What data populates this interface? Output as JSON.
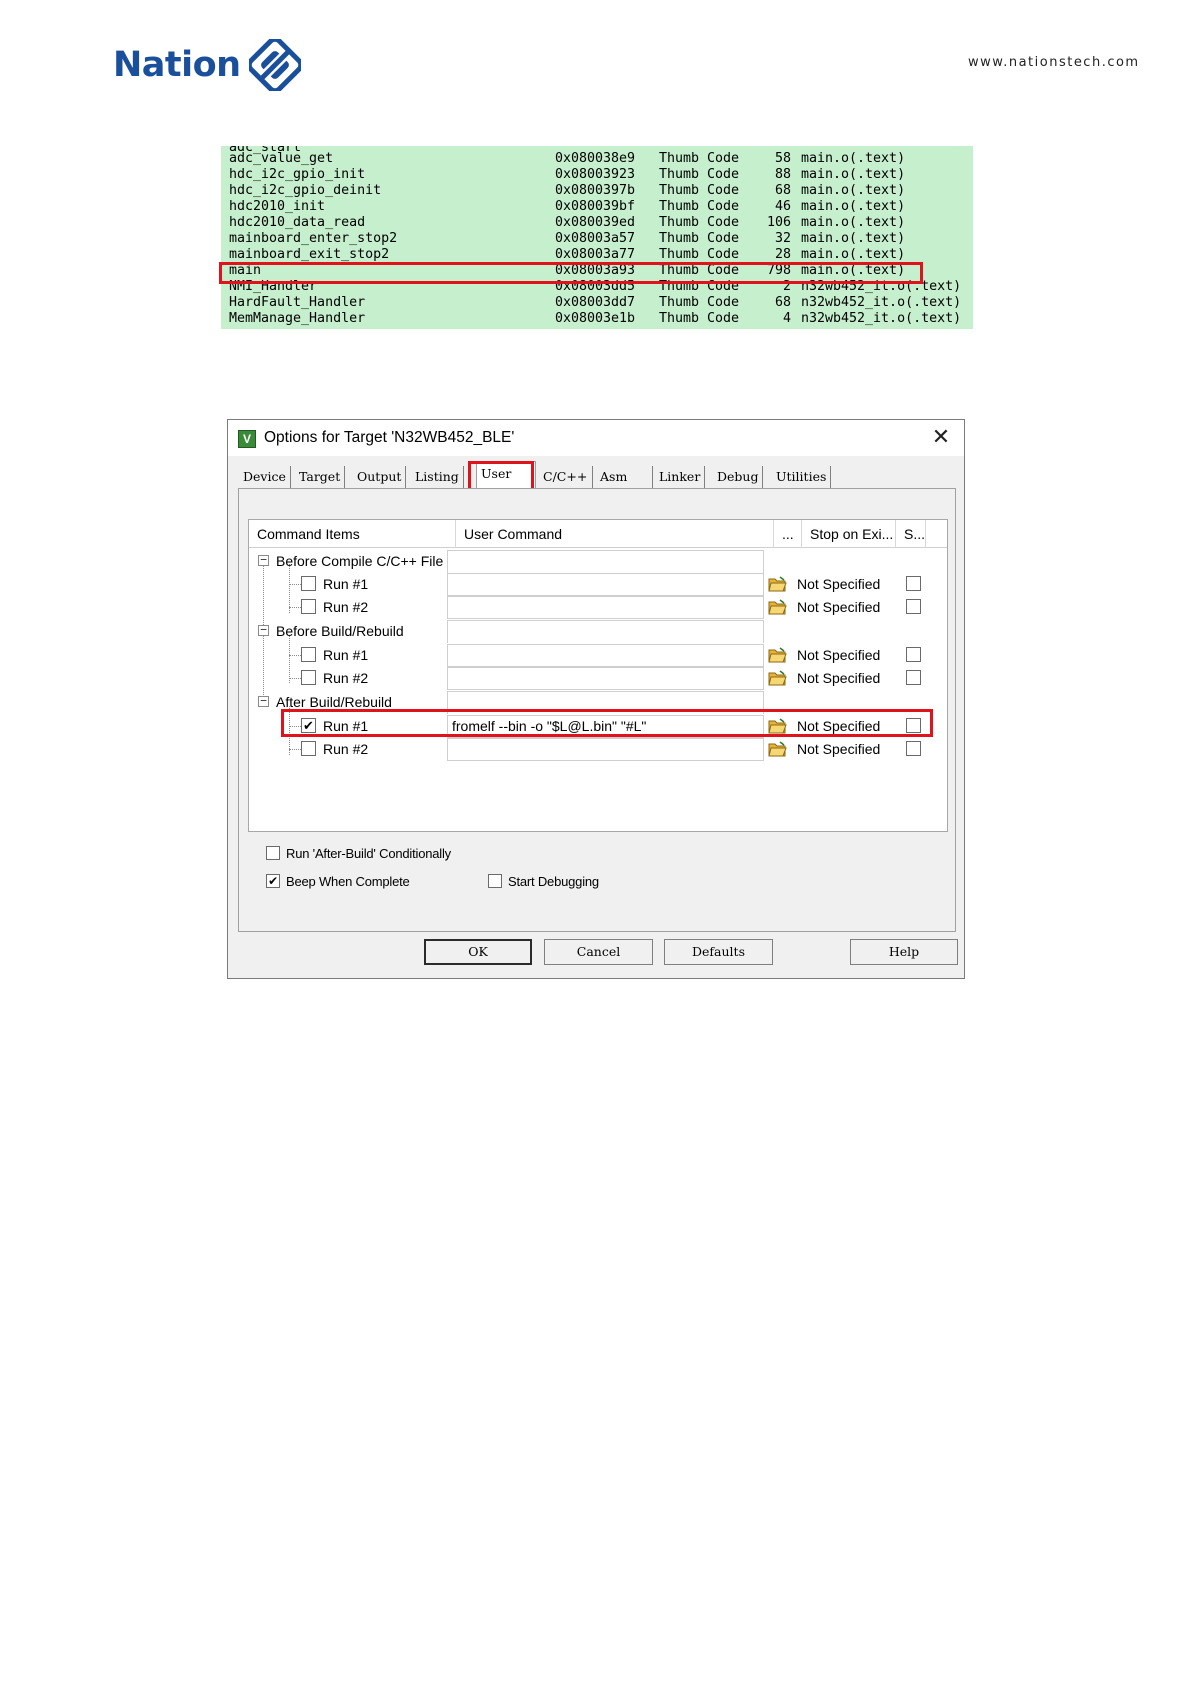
{
  "header": {
    "logo_text": "Nation",
    "website": "www.nationstech.com"
  },
  "map_listing": {
    "rows": [
      {
        "symbol": "adc_value_get",
        "address": "0x080038e9",
        "type": "Thumb Code",
        "size": "58",
        "object": "main.o(.text)"
      },
      {
        "symbol": "hdc_i2c_gpio_init",
        "address": "0x08003923",
        "type": "Thumb Code",
        "size": "88",
        "object": "main.o(.text)"
      },
      {
        "symbol": "hdc_i2c_gpio_deinit",
        "address": "0x0800397b",
        "type": "Thumb Code",
        "size": "68",
        "object": "main.o(.text)"
      },
      {
        "symbol": "hdc2010_init",
        "address": "0x080039bf",
        "type": "Thumb Code",
        "size": "46",
        "object": "main.o(.text)"
      },
      {
        "symbol": "hdc2010_data_read",
        "address": "0x080039ed",
        "type": "Thumb Code",
        "size": "106",
        "object": "main.o(.text)"
      },
      {
        "symbol": "mainboard_enter_stop2",
        "address": "0x08003a57",
        "type": "Thumb Code",
        "size": "32",
        "object": "main.o(.text)"
      },
      {
        "symbol": "mainboard_exit_stop2",
        "address": "0x08003a77",
        "type": "Thumb Code",
        "size": "28",
        "object": "main.o(.text)"
      },
      {
        "symbol": "main",
        "address": "0x08003a93",
        "type": "Thumb Code",
        "size": "798",
        "object": "main.o(.text)"
      },
      {
        "symbol": "NMI_Handler",
        "address": "0x08003dd5",
        "type": "Thumb Code",
        "size": "2",
        "object": "n32wb452_it.o(.text)"
      },
      {
        "symbol": "HardFault_Handler",
        "address": "0x08003dd7",
        "type": "Thumb Code",
        "size": "68",
        "object": "n32wb452_it.o(.text)"
      },
      {
        "symbol": "MemManage_Handler",
        "address": "0x08003e1b",
        "type": "Thumb Code",
        "size": "4",
        "object": "n32wb452_it.o(.text)"
      }
    ],
    "highlight_color": "#e0131d",
    "background_color": "#c6efce"
  },
  "dialog": {
    "title": "Options for Target 'N32WB452_BLE'",
    "close_glyph": "✕",
    "tabs": [
      {
        "label": "Device",
        "active": false
      },
      {
        "label": "Target",
        "active": false
      },
      {
        "label": "Output",
        "active": false
      },
      {
        "label": "Listing",
        "active": false
      },
      {
        "label": "User",
        "active": true
      },
      {
        "label": "C/C++",
        "active": false
      },
      {
        "label": "Asm",
        "active": false
      },
      {
        "label": "Linker",
        "active": false
      },
      {
        "label": "Debug",
        "active": false
      },
      {
        "label": "Utilities",
        "active": false
      }
    ],
    "columns": {
      "command_items": "Command Items",
      "user_command": "User Command",
      "browse": "...",
      "stop_on_exit": "Stop on Exi...",
      "s": "S..."
    },
    "groups": {
      "before_compile": {
        "label": "Before Compile C/C++ File",
        "run1": {
          "label": "Run #1",
          "checked": false,
          "command": "",
          "stop": "Not Specified"
        },
        "run2": {
          "label": "Run #2",
          "checked": false,
          "command": "",
          "stop": "Not Specified"
        }
      },
      "before_build": {
        "label": "Before Build/Rebuild",
        "run1": {
          "label": "Run #1",
          "checked": false,
          "command": "",
          "stop": "Not Specified"
        },
        "run2": {
          "label": "Run #2",
          "checked": false,
          "command": "",
          "stop": "Not Specified"
        }
      },
      "after_build": {
        "label": "After Build/Rebuild",
        "run1": {
          "label": "Run #1",
          "checked": true,
          "command": "fromelf --bin -o \"$L@L.bin\" \"#L\"",
          "stop": "Not Specified"
        },
        "run2": {
          "label": "Run #2",
          "checked": false,
          "command": "",
          "stop": "Not Specified"
        }
      }
    },
    "options": {
      "run_after_build_conditionally": {
        "label": "Run 'After-Build' Conditionally",
        "checked": false
      },
      "beep_when_complete": {
        "label": "Beep When Complete",
        "checked": true
      },
      "start_debugging": {
        "label": "Start Debugging",
        "checked": false
      }
    },
    "buttons": {
      "ok": "OK",
      "cancel": "Cancel",
      "defaults": "Defaults",
      "help": "Help"
    },
    "check_glyph": "✔"
  }
}
